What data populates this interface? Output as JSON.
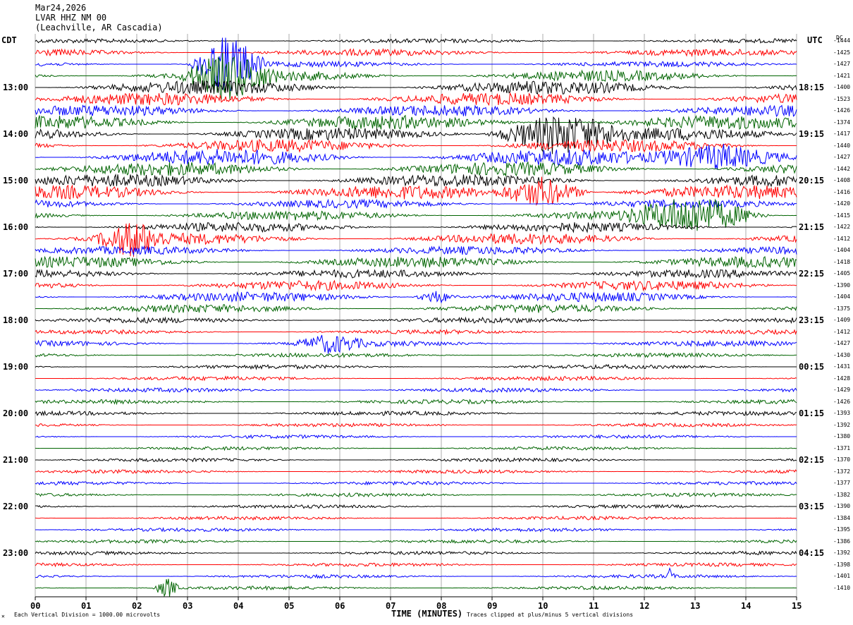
{
  "header": {
    "date": "Mar24,2026",
    "station": "LVAR HHZ NM 00",
    "location": "(Leachville, AR Cascadia)"
  },
  "left_timezone": "CDT",
  "right_timezone": "UTC",
  "dc_label": "DC",
  "footer": {
    "scale_note": "Each Vertical Division = 1000.00 microvolts",
    "clip_note": "Traces clipped at plus/minus 5 vertical divisions",
    "corner_mark": "✕"
  },
  "colors": {
    "trace_cycle": [
      "#000000",
      "#ff0000",
      "#0000ff",
      "#006400"
    ],
    "grid": "#888888"
  },
  "chart_data": {
    "type": "line",
    "title": "LVAR HHZ NM 00",
    "xlabel": "TIME (MINUTES)",
    "ylabel": "",
    "x_ticks": [
      "00",
      "01",
      "02",
      "03",
      "04",
      "05",
      "06",
      "07",
      "08",
      "09",
      "10",
      "11",
      "12",
      "13",
      "14",
      "15"
    ],
    "xlim": [
      0,
      15
    ],
    "left_hour_labels": [
      "13:00",
      "14:00",
      "15:00",
      "16:00",
      "17:00",
      "18:00",
      "19:00",
      "20:00",
      "21:00",
      "22:00",
      "23:00"
    ],
    "right_hour_labels": [
      "18:15",
      "19:15",
      "20:15",
      "21:15",
      "22:15",
      "23:15",
      "00:15",
      "01:15",
      "02:15",
      "03:15",
      "04:15"
    ],
    "dc_offsets": [
      "-1444",
      "-1425",
      "-1427",
      "-1421",
      "-1400",
      "-1523",
      "-1426",
      "-1374",
      "-1417",
      "-1440",
      "-1427",
      "-1442",
      "-1408",
      "-1416",
      "-1420",
      "-1415",
      "-1422",
      "-1412",
      "-1404",
      "-1418",
      "-1405",
      "-1390",
      "-1404",
      "-1375",
      "-1409",
      "-1412",
      "-1427",
      "-1430",
      "-1431",
      "-1428",
      "-1429",
      "-1426",
      "-1393",
      "-1392",
      "-1380",
      "-1371",
      "-1370",
      "-1372",
      "-1377",
      "-1382",
      "-1390",
      "-1384",
      "-1395",
      "-1386",
      "-1392",
      "-1398",
      "-1401",
      "-1410"
    ],
    "trace_count": 48,
    "trace_interval_minutes": 15,
    "trace_amplitude": [
      3,
      5,
      4,
      8,
      10,
      9,
      8,
      10,
      9,
      9,
      12,
      10,
      9,
      10,
      6,
      7,
      7,
      8,
      6,
      8,
      6,
      7,
      7,
      6,
      4,
      3,
      4,
      3,
      3,
      3,
      3,
      3,
      3,
      2.5,
      2.5,
      2.5,
      2.5,
      2.5,
      2.5,
      2.5,
      2.5,
      2.5,
      2.5,
      2.5,
      2.5,
      2.5,
      2.5,
      2.5
    ],
    "events": [
      {
        "trace": 2,
        "minute": 3.8,
        "amplitude": 45,
        "duration": 0.8
      },
      {
        "trace": 3,
        "minute": 3.8,
        "amplitude": 30,
        "duration": 1.0
      },
      {
        "trace": 8,
        "minute": 10.3,
        "amplitude": 30,
        "duration": 1.5
      },
      {
        "trace": 10,
        "minute": 13.5,
        "amplitude": 20,
        "duration": 1.5
      },
      {
        "trace": 13,
        "minute": 10.0,
        "amplitude": 22,
        "duration": 1.0
      },
      {
        "trace": 15,
        "minute": 13.0,
        "amplitude": 25,
        "duration": 1.5
      },
      {
        "trace": 17,
        "minute": 1.9,
        "amplitude": 22,
        "duration": 0.8
      },
      {
        "trace": 22,
        "minute": 7.9,
        "amplitude": 10,
        "duration": 0.5
      },
      {
        "trace": 26,
        "minute": 5.8,
        "amplitude": 12,
        "duration": 0.8
      },
      {
        "trace": 46,
        "minute": 12.5,
        "amplitude": 10,
        "duration": 0.1
      },
      {
        "trace": 47,
        "minute": 2.6,
        "amplitude": 14,
        "duration": 0.3
      }
    ]
  }
}
